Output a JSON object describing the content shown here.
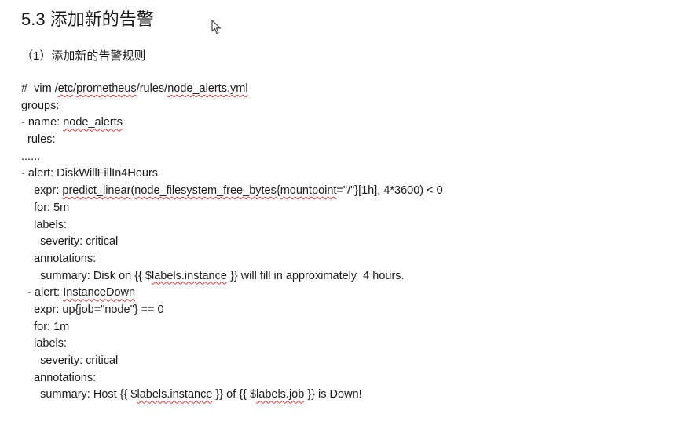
{
  "heading": {
    "number": "5.3",
    "title": "添加新的告警"
  },
  "subheading": "（1）添加新的告警规则",
  "code": {
    "l01_pre": "#  vim /",
    "l01_w1": "etc",
    "l01_m1": "/",
    "l01_w2": "prometheus",
    "l01_m2": "/rules/",
    "l01_w3": "node_alerts.yml",
    "l02": "groups:",
    "l03_pre": "- name: ",
    "l03_w1": "node_alerts",
    "l04": "  rules:",
    "l05": "......",
    "l06": "- alert: DiskWillFillIn4Hours",
    "l07_pre": "    expr: ",
    "l07_w1": "predict_linear",
    "l07_m1": "(",
    "l07_w2": "node_filesystem_free_bytes",
    "l07_m2": "{",
    "l07_w3": "mountpoint",
    "l07_post": "=\"/\"}[1h], 4*3600) < 0",
    "l08": "    for: 5m",
    "l09": "    labels:",
    "l10": "      severity: critical",
    "l11": "    annotations:",
    "l12_pre": "      summary: Disk on {{ $",
    "l12_w1": "labels.instance",
    "l12_post": " }} will fill in approximately  4 hours.",
    "l13_pre": "  - alert: ",
    "l13_w1": "InstanceDown",
    "l14": "    expr: up{job=\"node\"} == 0",
    "l15": "    for: 1m",
    "l16": "    labels:",
    "l17": "      severity: critical",
    "l18": "    annotations:",
    "l19_pre": "      summary: Host {{ $",
    "l19_w1": "labels.instance",
    "l19_m1": " }} of {{ $",
    "l19_w2": "labels.job",
    "l19_post": " }} is Down!"
  },
  "icons": {
    "cursor": "mouse-pointer-icon"
  }
}
